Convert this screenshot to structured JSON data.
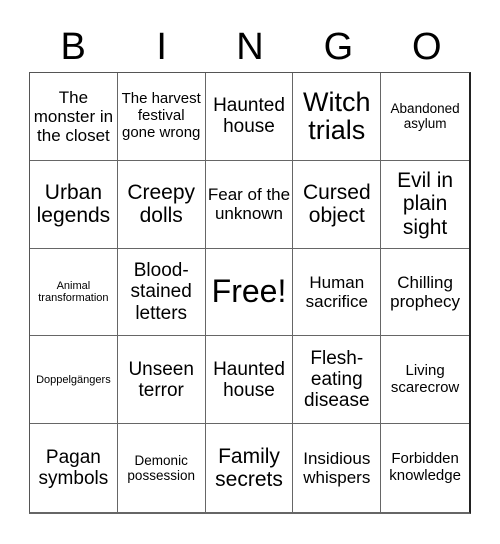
{
  "header": {
    "letters": [
      "B",
      "I",
      "N",
      "G",
      "O"
    ]
  },
  "board": {
    "cells": [
      "The monster in the closet",
      "The harvest festival gone wrong",
      "Haunted house",
      "Witch trials",
      "Abandoned asylum",
      "Urban legends",
      "Creepy dolls",
      "Fear of the unknown",
      "Cursed object",
      "Evil in plain sight",
      "Animal transformation",
      "Blood-stained letters",
      "Free!",
      "Human sacrifice",
      "Chilling prophecy",
      "Doppelgängers",
      "Unseen terror",
      "Haunted house",
      "Flesh-eating disease",
      "Living scarecrow",
      "Pagan symbols",
      "Demonic possession",
      "Family secrets",
      "Insidious whispers",
      "Forbidden knowledge"
    ],
    "free_space_index": 12
  }
}
